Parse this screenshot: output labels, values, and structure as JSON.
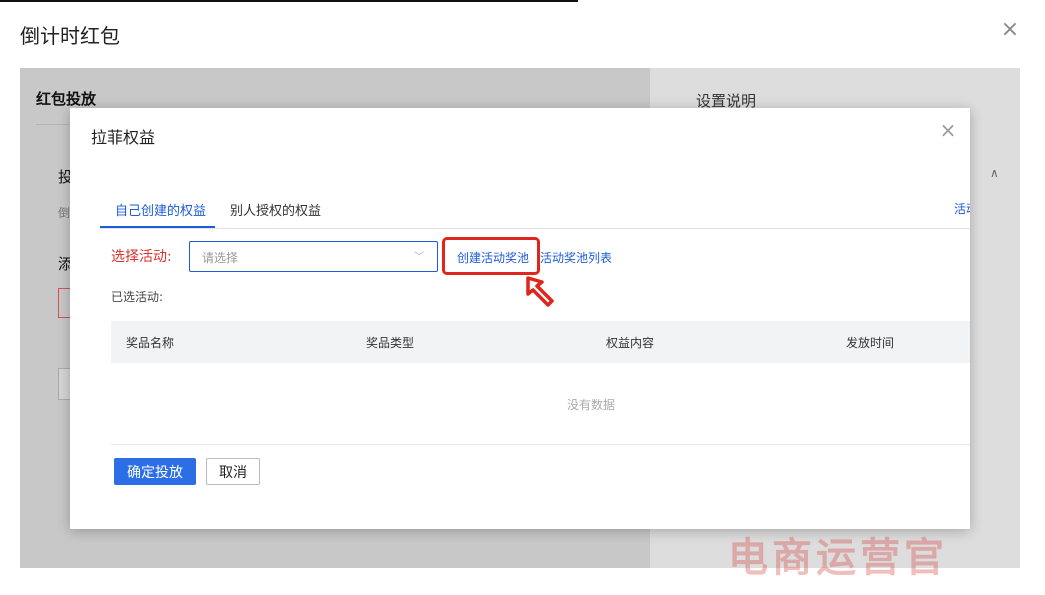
{
  "outer_dialog": {
    "title": "倒计时红包",
    "close_symbol": "×",
    "section_title": "红包投放",
    "left_fragments": [
      "投",
      "倒",
      "添"
    ],
    "right_panel_title": "设置说明",
    "right_chevron": "∧"
  },
  "inner_modal": {
    "title": "拉菲权益",
    "close_symbol": "×",
    "tabs": [
      {
        "label": "自己创建的权益",
        "active": true
      },
      {
        "label": "别人授权的权益",
        "active": false
      }
    ],
    "right_link_fragment": "活动",
    "select_label": "选择活动:",
    "select_placeholder": "请选择",
    "select_arrow": "﹀",
    "create_pool_link": "创建活动奖池",
    "pool_list_link": "活动奖池列表",
    "selected_label": "已选活动:",
    "table": {
      "columns": [
        "奖品名称",
        "奖品类型",
        "权益内容",
        "发放时间"
      ],
      "rows": [],
      "empty_text": "没有数据"
    },
    "confirm_button": "确定投放",
    "cancel_button": "取消"
  },
  "watermark": "电商运营官",
  "colors": {
    "primary": "#1e5cd6",
    "highlight_red": "#e0251c",
    "label_red": "#d9322b",
    "overlay": "#cdcdcd"
  },
  "icons": [
    "close-icon",
    "chevron-down-icon",
    "pointer-arrow-icon"
  ]
}
